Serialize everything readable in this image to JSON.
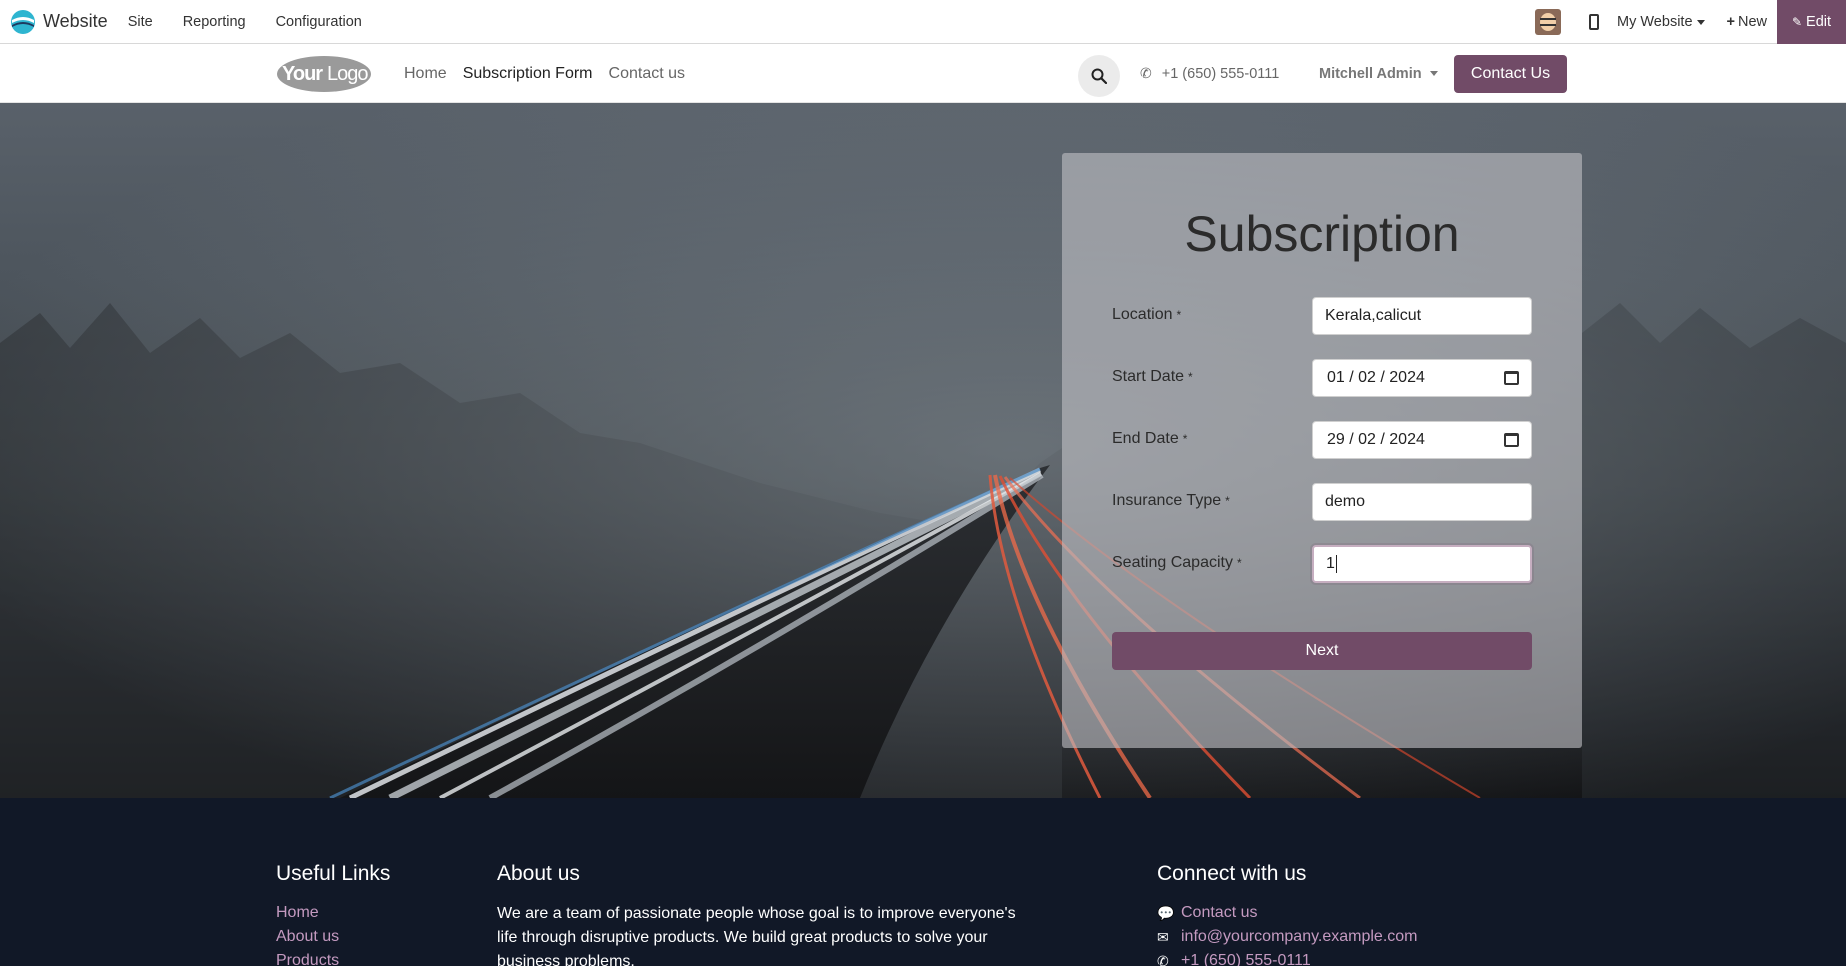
{
  "adminbar": {
    "app_name": "Website",
    "menu": [
      "Site",
      "Reporting",
      "Configuration"
    ],
    "my_website": "My Website",
    "new_label": "New",
    "edit_label": "Edit"
  },
  "header": {
    "logo_text": "YourLogo",
    "nav": [
      {
        "label": "Home",
        "active": false
      },
      {
        "label": "Subscription Form",
        "active": true
      },
      {
        "label": "Contact us",
        "active": false
      }
    ],
    "phone": "+1 (650) 555-0111",
    "user": "Mitchell Admin",
    "contact_button": "Contact Us"
  },
  "form": {
    "title": "Subscription",
    "fields": [
      {
        "label": "Location",
        "required": "*",
        "value": "Kerala,calicut",
        "type": "text"
      },
      {
        "label": "Start Date",
        "required": "*",
        "value": "01 / 02 / 2024",
        "type": "date"
      },
      {
        "label": "End Date",
        "required": "*",
        "value": "29 / 02 / 2024",
        "type": "date"
      },
      {
        "label": "Insurance Type",
        "required": "*",
        "value": "demo",
        "type": "text"
      },
      {
        "label": "Seating Capacity",
        "required": "*",
        "value": "1",
        "type": "text",
        "focused": true
      }
    ],
    "next_button": "Next"
  },
  "footer": {
    "useful_links_title": "Useful Links",
    "useful_links": [
      "Home",
      "About us",
      "Products"
    ],
    "about_title": "About us",
    "about_text": "We are a team of passionate people whose goal is to improve everyone's life through disruptive products. We build great products to solve your business problems.",
    "connect_title": "Connect with us",
    "connect": [
      {
        "icon": "comment-icon",
        "label": "Contact us"
      },
      {
        "icon": "envelope-icon",
        "label": "info@yourcompany.example.com"
      },
      {
        "icon": "phone-icon",
        "label": "+1 (650) 555-0111"
      }
    ]
  },
  "colors": {
    "brand": "#714b67",
    "footer_bg": "#111827",
    "footer_link": "#c49ac0"
  }
}
